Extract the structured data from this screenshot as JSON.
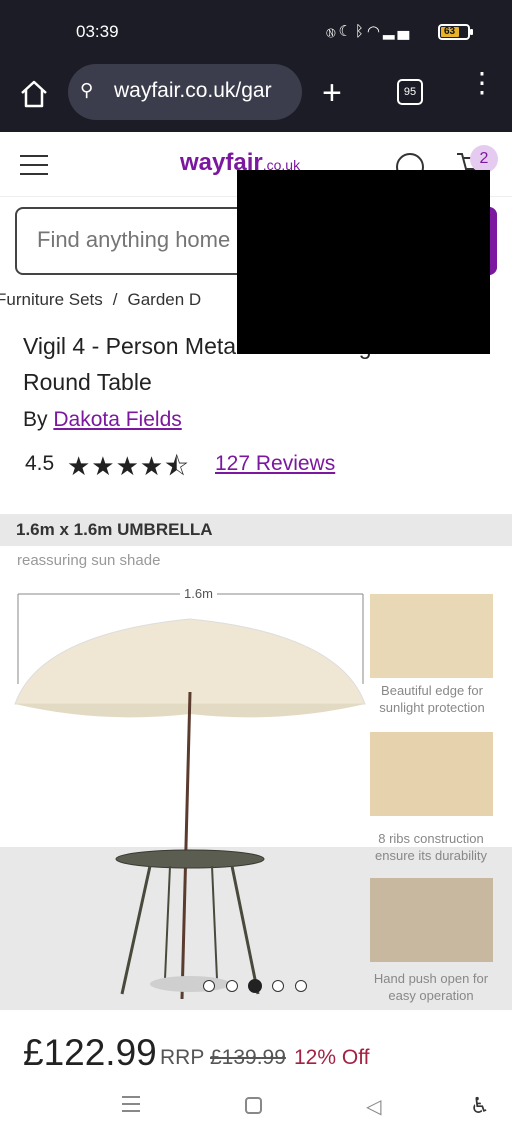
{
  "status_bar": {
    "time": "03:39",
    "icons": [
      "nfc-icon",
      "moon-icon",
      "bluetooth-icon",
      "wifi-icon",
      "signal-icon"
    ],
    "battery": "63"
  },
  "browser": {
    "url": "wayfair.co.uk/gar",
    "tab_count": "95"
  },
  "site_header": {
    "logo": "wayfair",
    "logo_suffix": ".co.uk",
    "cart_count": "2",
    "brand_color": "#7b189f"
  },
  "search": {
    "placeholder": "Find anything home"
  },
  "breadcrumb": [
    "Furniture Sets",
    "Garden D"
  ],
  "product": {
    "title": "Vigil 4 - Person Metal Patio Dining Set with Round Table",
    "by_label": "By",
    "brand": "Dakota Fields",
    "rating": "4.5",
    "stars_value": 4.5,
    "reviews": "127 Reviews"
  },
  "gallery": {
    "heading": "1.6m x 1.6m UMBRELLA",
    "subheading": "reassuring sun shade",
    "dimension": "1.6m",
    "captions": [
      "Beautiful edge for sunlight protection",
      "8 ribs construction ensure its durability",
      "Hand push open for easy operation"
    ],
    "slide_count": 5,
    "active_slide": 3
  },
  "pricing": {
    "price": "£122.99",
    "rrp_label": "RRP",
    "was_price": "£139.99",
    "discount": "12% Off",
    "discount_color": "#a32243"
  }
}
